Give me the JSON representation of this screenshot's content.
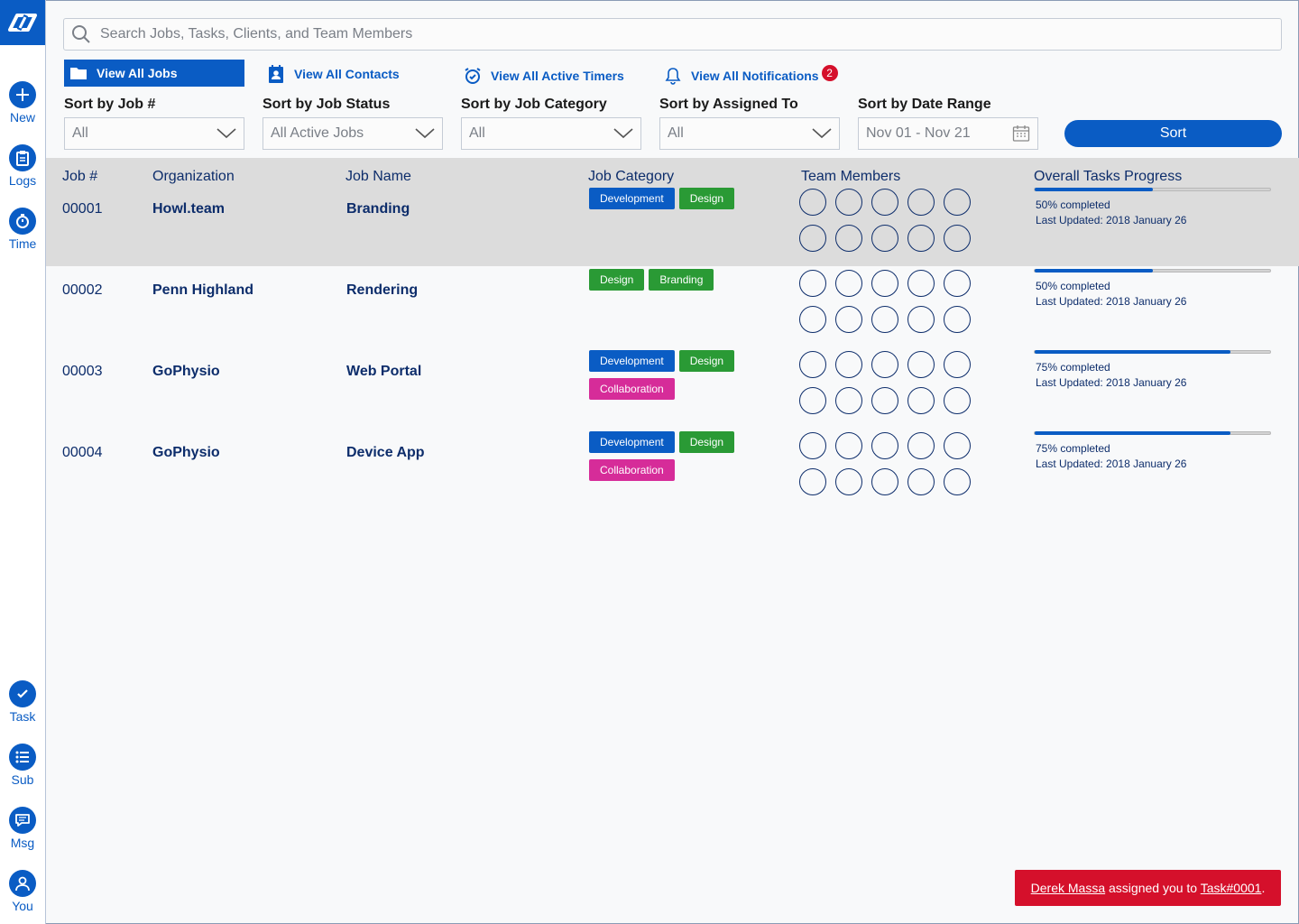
{
  "sidebar": {
    "logo_icon": "app-logo-icon",
    "top_items": [
      {
        "label": "New",
        "icon": "plus-icon"
      },
      {
        "label": "Logs",
        "icon": "clipboard-icon"
      },
      {
        "label": "Time",
        "icon": "stopwatch-icon"
      }
    ],
    "bottom_items": [
      {
        "label": "Task",
        "icon": "check-icon"
      },
      {
        "label": "Sub",
        "icon": "list-icon"
      },
      {
        "label": "Msg",
        "icon": "message-icon"
      },
      {
        "label": "You",
        "icon": "user-icon"
      }
    ]
  },
  "search": {
    "placeholder": "Search Jobs, Tasks, Clients, and Team Members"
  },
  "nav": {
    "all_jobs": "View All Jobs",
    "contacts": "View All Contacts",
    "timers": "View All Active Timers",
    "notifications": "View All Notifications",
    "notification_count": "2"
  },
  "filters": {
    "job_label": "Sort by Job #",
    "job_value": "All",
    "status_label": "Sort by Job Status",
    "status_value": "All Active Jobs",
    "category_label": "Sort by Job Category",
    "category_value": "All",
    "assigned_label": "Sort by Assigned To",
    "assigned_value": "All",
    "date_label": "Sort by Date Range",
    "date_value": "Nov 01 - Nov 21",
    "sort_button": "Sort"
  },
  "table": {
    "headers": {
      "job": "Job #",
      "org": "Organization",
      "name": "Job Name",
      "category": "Job Category",
      "members": "Team Members",
      "progress": "Overall Tasks Progress"
    },
    "rows": [
      {
        "job": "00001",
        "org": "Howl.team",
        "name": "Branding",
        "tags": [
          "Development",
          "Design"
        ],
        "progress_pct": 50,
        "progress_text": "50% completed",
        "updated": "Last Updated: 2018 January 26"
      },
      {
        "job": "00002",
        "org": "Penn Highland",
        "name": "Rendering",
        "tags": [
          "Design",
          "Branding"
        ],
        "progress_pct": 50,
        "progress_text": "50% completed",
        "updated": "Last Updated: 2018 January 26"
      },
      {
        "job": "00003",
        "org": "GoPhysio",
        "name": "Web Portal",
        "tags": [
          "Development",
          "Design",
          "Collaboration"
        ],
        "progress_pct": 83,
        "progress_text": "75% completed",
        "updated": "Last Updated: 2018 January 26"
      },
      {
        "job": "00004",
        "org": "GoPhysio",
        "name": "Device App",
        "tags": [
          "Development",
          "Design",
          "Collaboration"
        ],
        "progress_pct": 83,
        "progress_text": "75% completed",
        "updated": "Last Updated: 2018 January 26"
      }
    ]
  },
  "toast": {
    "user": "Derek Massa",
    "middle": " assigned you to ",
    "task": "Task#0001",
    "end": "."
  },
  "colors": {
    "primary": "#0a5cc4",
    "design_tag": "#2a9a35",
    "collab_tag": "#d62c99",
    "alert": "#d5102b"
  }
}
